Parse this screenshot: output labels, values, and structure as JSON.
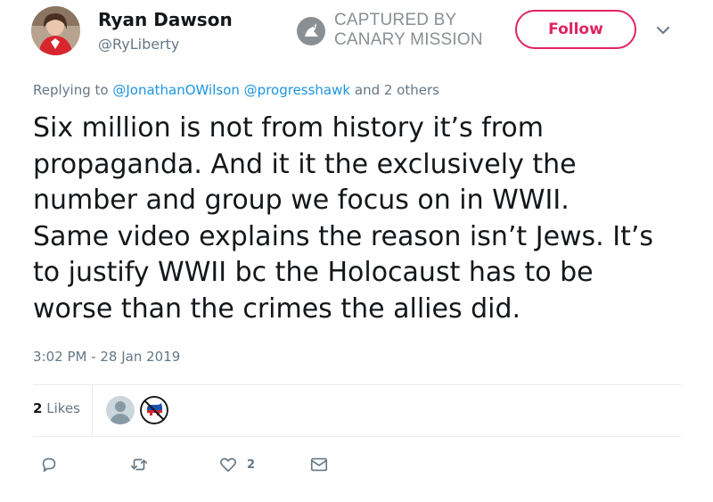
{
  "author": {
    "name": "Ryan Dawson",
    "handle": "@RyLiberty"
  },
  "stamp": {
    "line1": "CAPTURED BY",
    "line2": "CANARY MISSION"
  },
  "follow_label": "Follow",
  "reply": {
    "prefix": "Replying to",
    "mention1": "@JonathanOWilson",
    "mention2": "@progresshawk",
    "suffix": "and 2 others"
  },
  "tweet": {
    "line1": "Six million is not from history it’s from",
    "line2": "propaganda. And it it the exclusively the",
    "line3": "number and group we focus on in WWII.",
    "line4": "Same video explains the reason isn’t Jews. It’s",
    "line5": "to justify WWII bc the Holocaust has to be",
    "line6": "worse than the crimes the allies did."
  },
  "timestamp": "3:02 PM - 28 Jan 2019",
  "likes": {
    "count": "2",
    "label": "Likes"
  },
  "actions": {
    "reply_icon": "reply-icon",
    "retweet_icon": "retweet-icon",
    "like_icon": "heart-icon",
    "like_count": "2",
    "message_icon": "envelope-icon"
  },
  "colors": {
    "accent": "#e0245e",
    "link": "#1b95e0",
    "muted": "#657786"
  }
}
